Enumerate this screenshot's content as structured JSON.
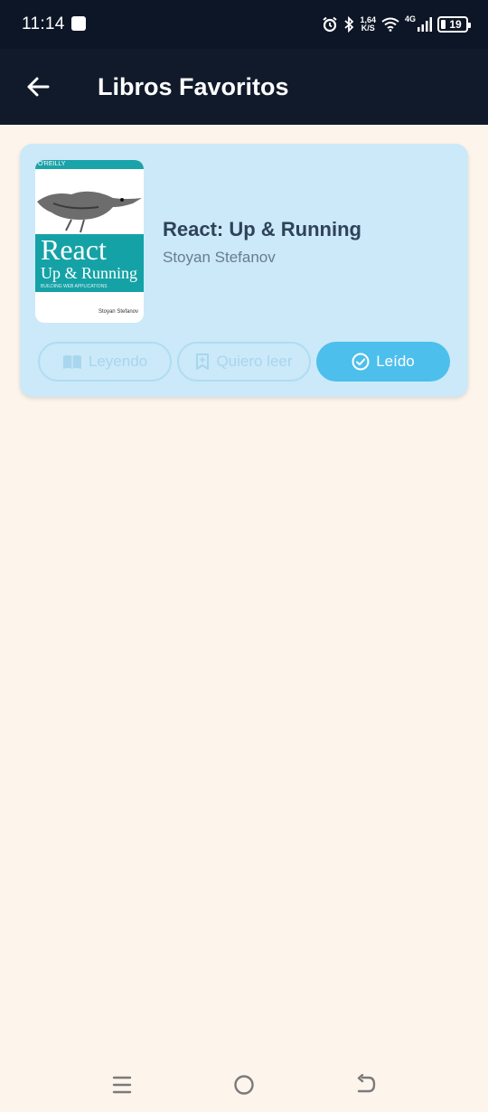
{
  "status_bar": {
    "time": "11:14",
    "net_speed_value": "1,64",
    "net_speed_unit": "K/S",
    "network_type": "4G",
    "battery": "19"
  },
  "app_bar": {
    "title": "Libros Favoritos",
    "back_icon": "arrow-left-icon"
  },
  "books": [
    {
      "title": "React: Up & Running",
      "author": "Stoyan Stefanov",
      "cover": {
        "publisher": "O'REILLY",
        "title_line1": "React",
        "title_line2": "Up & Running",
        "tagline": "BUILDING WEB APPLICATIONS",
        "author": "Stoyan Stefanov"
      },
      "actions": [
        {
          "label": "Leyendo",
          "icon": "book-open-icon",
          "active": false
        },
        {
          "label": "Quiero leer",
          "icon": "bookmark-icon",
          "active": false
        },
        {
          "label": "Leído",
          "icon": "check-circle-icon",
          "active": true
        }
      ]
    }
  ],
  "colors": {
    "background": "#fdf4ec",
    "app_bar": "#111a2b",
    "card": "#cbe9f8",
    "accent": "#4cbfec"
  }
}
